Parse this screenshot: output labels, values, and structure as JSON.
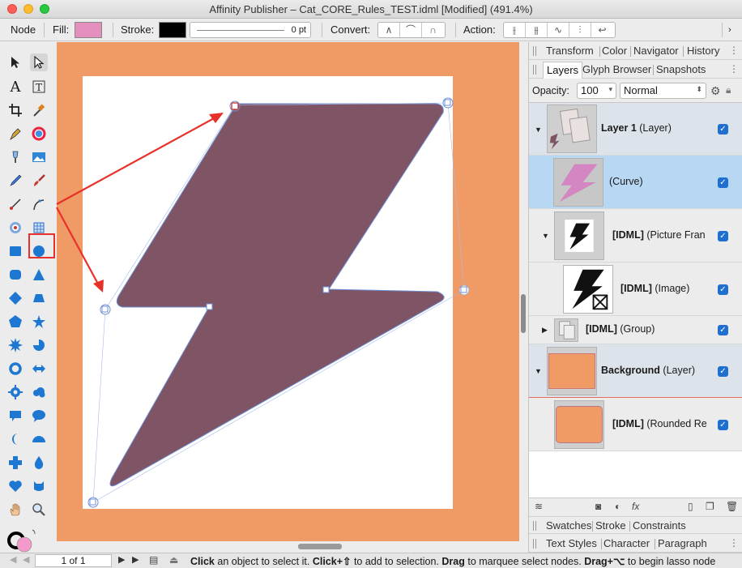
{
  "window": {
    "title": "Affinity Publisher – Cat_CORE_Rules_TEST.idml [Modified] (491.4%)"
  },
  "context_toolbar": {
    "node_label": "Node",
    "fill_label": "Fill:",
    "fill_color": "#e58fbf",
    "stroke_label": "Stroke:",
    "stroke_color": "#000000",
    "stroke_width": "0 pt",
    "convert_label": "Convert:",
    "convert_buttons": [
      "sharp-node-icon",
      "smooth-node-icon",
      "smart-node-icon"
    ],
    "action_label": "Action:",
    "action_buttons": [
      "break-curve-icon",
      "join-curves-icon",
      "smooth-curve-icon",
      "reverse-curve-icon",
      "close-curve-icon"
    ]
  },
  "colors": {
    "canvas_background": "#f09a66",
    "shape_fill": "#7f5464",
    "selection_accent": "#6f8fd4",
    "callout_red": "#e8302a",
    "layer_selected": "#b7d7f3",
    "checkbox_blue": "#1f6fd0"
  },
  "tools": [
    "move-tool-icon",
    "node-tool-icon",
    "artistic-text-tool-icon",
    "frame-text-tool-icon",
    "crop-tool-icon",
    "color-picker-icon",
    "pen-tool-icon",
    "fill-tool-icon",
    "transparency-tool-icon",
    "place-image-tool-icon",
    "pencil-tool-icon",
    "brush-tool-icon",
    "vector-crop-tool-icon",
    "corner-tool-icon",
    "target-tool-icon",
    "table-tool-icon",
    "rectangle-tool-icon",
    "ellipse-tool-icon",
    "rounded-rectangle-tool-icon",
    "triangle-tool-icon",
    "diamond-tool-icon",
    "trapezoid-tool-icon",
    "polygon-tool-icon",
    "star-tool-icon",
    "star-burst-tool-icon",
    "pie-tool-icon",
    "donut-tool-icon",
    "double-arrow-tool-icon",
    "cog-tool-icon",
    "cloud-tool-icon",
    "square-callout-tool-icon",
    "ellipse-callout-tool-icon",
    "crescent-tool-icon",
    "segment-tool-icon",
    "cross-tool-icon",
    "tear-tool-icon",
    "heart-tool-icon",
    "cat-tool-icon",
    "hand-tool-icon",
    "zoom-tool-icon"
  ],
  "panels": {
    "top_tabs": [
      "Transform",
      "Color",
      "Navigator",
      "History"
    ],
    "layer_tabs": [
      "Layers",
      "Glyph Browser",
      "Snapshots"
    ],
    "opacity_label": "Opacity:",
    "opacity_value": "100",
    "blend_mode": "Normal",
    "layers": [
      {
        "name": "Layer 1",
        "type": "(Layer)",
        "bold": true
      },
      {
        "name": "",
        "type": "(Curve)",
        "bold": false
      },
      {
        "name": "[IDML]",
        "type": "(Picture Fran",
        "bold": true
      },
      {
        "name": "[IDML]",
        "type": "(Image)",
        "bold": true
      },
      {
        "name": "[IDML]",
        "type": "(Group)",
        "bold": true
      },
      {
        "name": "Background",
        "type": "(Layer)",
        "bold": true
      },
      {
        "name": "[IDML]",
        "type": "(Rounded Re",
        "bold": true
      }
    ],
    "bottom_tabs_1": [
      "Swatches",
      "Stroke",
      "Constraints"
    ],
    "bottom_tabs_2": [
      "Text Styles",
      "Character",
      "Paragraph"
    ]
  },
  "status": {
    "page": "1 of 1",
    "click": "Click",
    "t1": "an object to select it.",
    "click2": "Click+⇧",
    "t2": "to add to selection.",
    "drag": "Drag",
    "t3": "to marquee select nodes.",
    "drag2": "Drag+⌥",
    "t4": "to begin lasso node"
  }
}
